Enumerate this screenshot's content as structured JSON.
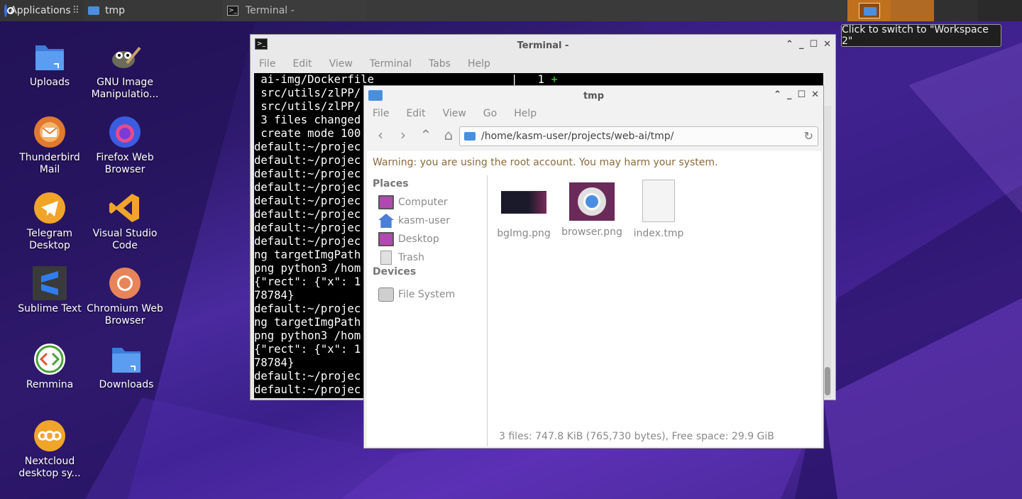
{
  "top_panel": {
    "applications_label": "Applications",
    "tasks": [
      {
        "label": "tmp"
      },
      {
        "label": "Terminal -"
      }
    ]
  },
  "tooltip": {
    "text": "Click to switch to \"Workspace 2\""
  },
  "desktop": {
    "icons": [
      {
        "label": "Uploads"
      },
      {
        "label": "GNU Image Manipulatio..."
      },
      {
        "label": "Thunderbird Mail"
      },
      {
        "label": "Firefox Web Browser"
      },
      {
        "label": "Telegram Desktop"
      },
      {
        "label": "Visual Studio Code"
      },
      {
        "label": "Sublime Text"
      },
      {
        "label": "Chromium Web Browser"
      },
      {
        "label": "Remmina"
      },
      {
        "label": "Downloads"
      },
      {
        "label": "Nextcloud desktop sy..."
      }
    ]
  },
  "terminal": {
    "title": "Terminal -",
    "menu": [
      "File",
      "Edit",
      "View",
      "Terminal",
      "Tabs",
      "Help"
    ],
    "lines": [
      " ai-img/Dockerfile",
      " src/utils/zlPP/",
      " src/utils/zlPP/",
      " 3 files changed",
      " create mode 100",
      "default:~/projec",
      "default:~/projec",
      "default:~/projec",
      "default:~/projec",
      "default:~/projec",
      "default:~/projec",
      "default:~/projec",
      "default:~/projec",
      "ng targetImgPath",
      "png python3 /hom",
      "{\"rect\": {\"x\": 1",
      "78784}",
      "default:~/projec",
      "ng targetImgPath",
      "png python3 /hom",
      "{\"rect\": {\"x\": 1",
      "78784}",
      "default:~/projec",
      "default:~/projec"
    ],
    "diff_stat": "|   1 +"
  },
  "file_manager": {
    "title": "tmp",
    "menu": [
      "File",
      "Edit",
      "View",
      "Go",
      "Help"
    ],
    "path": "/home/kasm-user/projects/web-ai/tmp/",
    "warning": "Warning: you are using the root account. You may harm your system.",
    "sidebar": {
      "places_label": "Places",
      "places": [
        {
          "label": "Computer",
          "icon": "computer-icon"
        },
        {
          "label": "kasm-user",
          "icon": "home-folder-icon"
        },
        {
          "label": "Desktop",
          "icon": "desktop-icon"
        },
        {
          "label": "Trash",
          "icon": "trash-icon"
        }
      ],
      "devices_label": "Devices",
      "devices": [
        {
          "label": "File System",
          "icon": "drive-icon"
        }
      ]
    },
    "files": [
      {
        "name": "bgImg.png"
      },
      {
        "name": "browser.png"
      },
      {
        "name": "index.tmp"
      }
    ],
    "status": "3 files: 747.8 KiB (765,730 bytes), Free space: 29.9 GiB"
  }
}
